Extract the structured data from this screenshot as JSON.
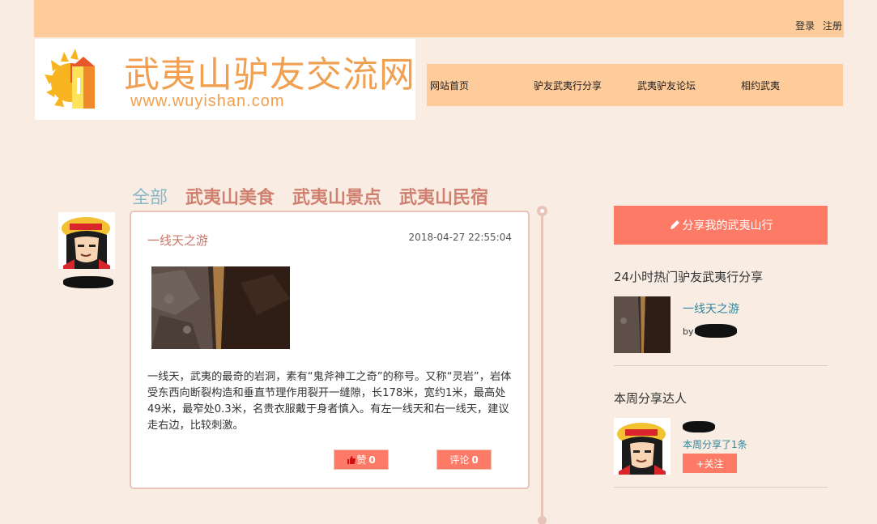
{
  "header": {
    "login_label": "登录",
    "register_label": "注册"
  },
  "logo": {
    "brand_name": "武夷山驴友交流网",
    "url_text": "www.wuyishan.com"
  },
  "nav": {
    "items": [
      {
        "label": "网站首页"
      },
      {
        "label": "驴友武夷行分享"
      },
      {
        "label": "武夷驴友论坛"
      },
      {
        "label": "相约武夷"
      }
    ]
  },
  "categories": {
    "active": "全部",
    "items": [
      {
        "label": "全部"
      },
      {
        "label": "武夷山美食"
      },
      {
        "label": "武夷山景点"
      },
      {
        "label": "武夷山民宿"
      }
    ]
  },
  "post": {
    "title": "一线天之游",
    "timestamp": "2018-04-27 22:55:04",
    "body": "一线天，武夷的最奇的岩洞，素有“鬼斧神工之奇”的称号。又称“灵岩”，岩体受东西向断裂构造和垂直节理作用裂开一缝隙，长178米，宽约1米，最高处49米，最窄处0.3米，名贵衣服戴于身者慎入。有左一线天和右一线天，建议走右边，比较刺激。",
    "like_label": "赞",
    "like_count": "0",
    "comment_label": "评论",
    "comment_count": "0"
  },
  "sidebar": {
    "share_button_label": "分享我的武夷山行",
    "hot_heading": "24小时热门驴友武夷行分享",
    "hot_item": {
      "title": "一线天之游",
      "by_label": "by"
    },
    "star_heading": "本周分享达人",
    "star_user": {
      "share_info": "本周分享了1条",
      "follow_label": "+关注"
    }
  },
  "colors": {
    "header_bg": "#fecb9a",
    "page_bg": "#f9ede3",
    "accent": "#fd7b66",
    "link": "#31859c",
    "category": "#d08070",
    "category_active": "#88b8c8"
  }
}
